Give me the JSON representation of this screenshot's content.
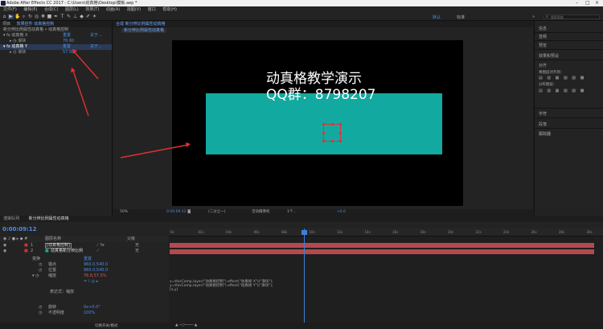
{
  "window": {
    "title": "Adobe After Effects CC 2017 - C:\\Users\\动真格\\Desktop\\模板.aep *"
  },
  "menu": [
    "文件(F)",
    "编辑(E)",
    "合成(C)",
    "图层(L)",
    "效果(T)",
    "动画(A)",
    "视图(V)",
    "窗口",
    "帮助(H)"
  ],
  "toolbar": {
    "workspace_default": "默认",
    "workspace_standard": "标准",
    "search_placeholder": "搜索帮助"
  },
  "left_panel": {
    "tabs": [
      "项目",
      "效果控件 动真格控制"
    ],
    "breadcrumb": "新分辨比例属性动真格 • 动真格控制",
    "effects": [
      {
        "name": "动真格 X",
        "value": "重置",
        "extra": "关于..."
      },
      {
        "name": "滑块",
        "value": "76.60",
        "extra": ""
      },
      {
        "name": "动真格 Y",
        "value": "重置",
        "extra": "关于..."
      },
      {
        "name": "滑块",
        "value": "57.50",
        "extra": ""
      }
    ]
  },
  "comp_panel": {
    "tab": "合成 新分辨比例属性动真格",
    "subtab": "新分辨比例属性动真格",
    "overlay_line1": "动真格教学演示",
    "overlay_line2": "QQ群：8798207",
    "footer": {
      "zoom": "50%",
      "timecode": "0:00:09:12",
      "resolution": "(二分之一)",
      "camera": "活动摄像机",
      "views": "1个...",
      "offset": "+0.0"
    },
    "bg_color": "#000000",
    "teal_color": "#12aaa0"
  },
  "right_panel": {
    "items": [
      "信息",
      "音频",
      "预览",
      "效果和预设",
      "对齐",
      "将图层对齐到：",
      "选区",
      "分布图层：",
      "字符",
      "段落",
      "跟踪器"
    ]
  },
  "timeline": {
    "tabs": [
      "渲染队列",
      "新分辨比例属性动真格"
    ],
    "timecode": "0:00:09:12",
    "columns": {
      "source": "图层名称",
      "parent": "父级"
    },
    "layers": [
      {
        "num": "1",
        "name": "[动真格控制]",
        "parent": "无"
      },
      {
        "num": "2",
        "name": "动真格新分辨比例",
        "parent": "无"
      }
    ],
    "properties": [
      {
        "label": "变换",
        "value": "重置"
      },
      {
        "label": "锚点",
        "value": "960.0,540.0"
      },
      {
        "label": "位置",
        "value": "960.0,540.0"
      },
      {
        "label": "缩放",
        "value": "76.6,57.5%"
      },
      {
        "label": "表达式：缩放",
        "value": ""
      },
      {
        "label": "旋转",
        "value": "0x+0.0°"
      },
      {
        "label": "不透明度",
        "value": "100%"
      }
    ],
    "expression": "x=thisComp.layer(\"动真格控制\").effect(\"动真格 X\")(\"滑块\");\ny=thisComp.layer(\"动真格控制\").effect(\"动真格 Y\")(\"滑块\");\n[x,y]",
    "ruler": [
      "0s",
      "02s",
      "04s",
      "06s",
      "08s",
      "10s",
      "12s",
      "14s",
      "16s",
      "18s",
      "20s",
      "22s",
      "24s",
      "26s",
      "28s",
      "30s"
    ],
    "footer_toggle": "切换开关/模式"
  }
}
